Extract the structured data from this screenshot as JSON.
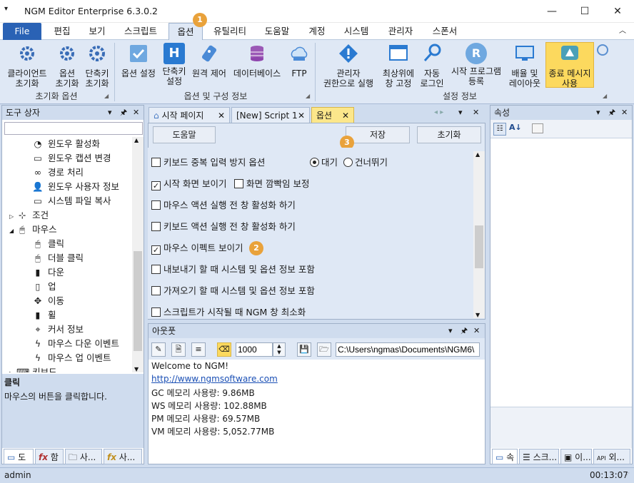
{
  "window": {
    "app_name": "NGM Editor",
    "edition": "Enterprise 6.3.0.2",
    "minimize": "—",
    "maximize": "☐",
    "close": "✕"
  },
  "menu": {
    "file": "File",
    "tabs": [
      "편집",
      "보기",
      "스크립트",
      "옵션",
      "유틸리티",
      "도움말",
      "계정",
      "시스템",
      "관리자",
      "스폰서"
    ],
    "collapse": "︿"
  },
  "ribbon": {
    "group1": {
      "label": "초기화 옵션",
      "buttons": [
        {
          "l1": "클라이언트",
          "l2": "초기화"
        },
        {
          "l1": "옵션",
          "l2": "초기화"
        },
        {
          "l1": "단축키",
          "l2": "초기화"
        }
      ]
    },
    "group2": {
      "label": "옵션 및 구성 정보",
      "buttons": [
        {
          "l1": "옵션 설정",
          "l2": ""
        },
        {
          "l1": "단축키",
          "l2": "설정"
        },
        {
          "l1": "원격 제어",
          "l2": ""
        },
        {
          "l1": "데이터베이스",
          "l2": ""
        },
        {
          "l1": "FTP",
          "l2": ""
        }
      ]
    },
    "group3": {
      "label": "설정 정보",
      "buttons": [
        {
          "l1": "관리자",
          "l2": "권한으로 실행"
        },
        {
          "l1": "최상위에",
          "l2": "창 고정"
        },
        {
          "l1": "자동",
          "l2": "로그인"
        },
        {
          "l1": "시작 프로그램",
          "l2": "등록"
        },
        {
          "l1": "배율 및",
          "l2": "레이아웃"
        },
        {
          "l1": "종료 메시지",
          "l2": "사용"
        }
      ]
    },
    "icon_h_letter": "H",
    "icon_r_letter": "R"
  },
  "toolbox": {
    "title": "도구 상자",
    "items": [
      {
        "label": "윈도우 활성화",
        "indent": 2
      },
      {
        "label": "윈도우 캡션 변경",
        "indent": 2
      },
      {
        "label": "경로 처리",
        "indent": 2
      },
      {
        "label": "윈도우 사용자 정보",
        "indent": 2
      },
      {
        "label": "시스템 파일 복사",
        "indent": 2
      },
      {
        "label": "조건",
        "indent": 1
      },
      {
        "label": "마우스",
        "indent": 1
      },
      {
        "label": "클릭",
        "indent": 2
      },
      {
        "label": "더블 클릭",
        "indent": 2
      },
      {
        "label": "다운",
        "indent": 2
      },
      {
        "label": "업",
        "indent": 2
      },
      {
        "label": "이동",
        "indent": 2
      },
      {
        "label": "휠",
        "indent": 2
      },
      {
        "label": "커서 정보",
        "indent": 2
      },
      {
        "label": "마우스 다운 이벤트",
        "indent": 2
      },
      {
        "label": "마우스 업 이벤트",
        "indent": 2
      },
      {
        "label": "키보드",
        "indent": 1
      }
    ],
    "desc_title": "클릭",
    "desc_text": "마우스의 버튼을 클릭합니다.",
    "bottom_tabs": [
      "도",
      "함",
      "사...",
      "사..."
    ]
  },
  "doc_tabs": [
    {
      "label": "시작 페이지"
    },
    {
      "label": "[New] Script 1"
    },
    {
      "label": "옵션"
    }
  ],
  "options": {
    "help_button": "도움말",
    "save_button": "저장",
    "reset_button": "초기화",
    "rows": [
      {
        "label": "키보드 중복 입력 방지 옵션",
        "checked": false
      },
      {
        "label": "시작 화면 보이기",
        "checked": true
      },
      {
        "label": "마우스 액션 실행 전 창 활성화 하기",
        "checked": false
      },
      {
        "label": "키보드 액션 실행 전 창 활성화 하기",
        "checked": false
      },
      {
        "label": "마우스 이펙트 보이기",
        "checked": true
      },
      {
        "label": "내보내기 할 때 시스템 및 옵션 정보 포함",
        "checked": false
      },
      {
        "label": "가져오기 할 때 시스템 및 옵션 정보 포함",
        "checked": false
      },
      {
        "label": "스크립트가 시작될 때 NGM 창 최소화",
        "checked": false
      }
    ],
    "flicker_label": "화면 깜빡임 보정",
    "radio_wait": "대기",
    "radio_skip": "건너뛰기"
  },
  "badges": [
    "1",
    "2",
    "3"
  ],
  "output": {
    "title": "아웃풋",
    "count_value": "1000",
    "path_value": "C:\\Users\\ngmas\\Documents\\NGM6\\",
    "lines": [
      "Welcome to NGM!",
      "http://www.ngmsoftware.com",
      "GC 메모리 사용량: 9.86MB",
      "WS 메모리 사용량: 102.88MB",
      "PM 메모리 사용량: 69.57MB",
      "VM 메모리 사용량: 5,052.77MB"
    ]
  },
  "properties": {
    "title": "속성",
    "bottom_tabs": [
      "속",
      "스크...",
      "이...",
      "외..."
    ]
  },
  "status": {
    "user": "admin",
    "time": "00:13:07"
  },
  "colors": {
    "accent": "#2a62b5",
    "highlight": "#fcd95e",
    "badge": "#e9a23b",
    "link": "#1a4fb5"
  }
}
